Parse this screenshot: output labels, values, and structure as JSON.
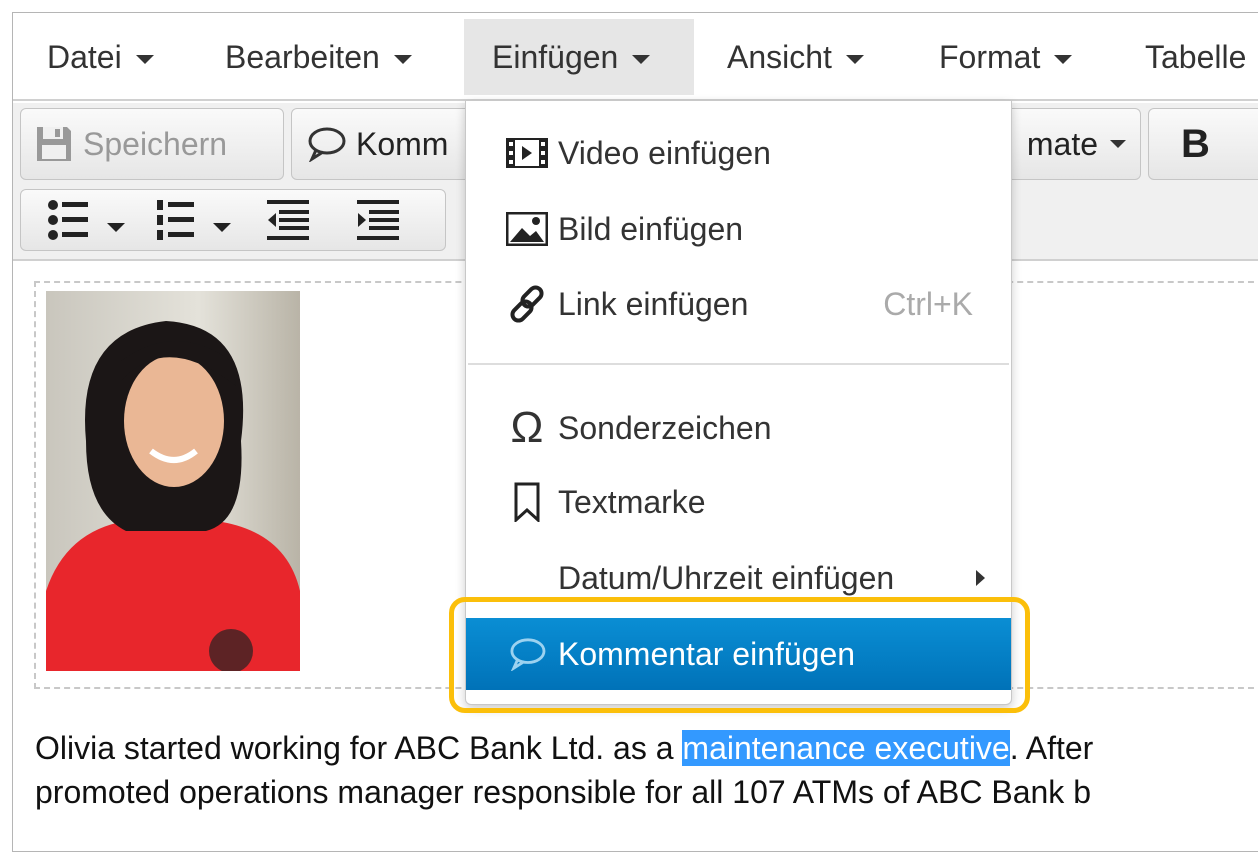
{
  "menubar": {
    "items": [
      {
        "label": "Datei"
      },
      {
        "label": "Bearbeiten"
      },
      {
        "label": "Einfügen",
        "active": true
      },
      {
        "label": "Ansicht"
      },
      {
        "label": "Format"
      },
      {
        "label": "Tabelle"
      }
    ]
  },
  "toolbar": {
    "save_label": "Speichern",
    "comment_label": "Komm",
    "formats_label": "mate",
    "bold_label": "B"
  },
  "dropdown": {
    "items": [
      {
        "label": "Video einfügen",
        "icon": "film-icon"
      },
      {
        "label": "Bild einfügen",
        "icon": "image-icon"
      },
      {
        "label": "Link einfügen",
        "icon": "link-icon",
        "shortcut": "Ctrl+K"
      },
      {
        "label": "Sonderzeichen",
        "icon": "omega-icon"
      },
      {
        "label": "Textmarke",
        "icon": "bookmark-icon"
      },
      {
        "label": "Datum/Uhrzeit einfügen",
        "submenu": true
      },
      {
        "label": "Kommentar einfügen",
        "icon": "comment-icon",
        "highlighted": true
      }
    ]
  },
  "content": {
    "line1_before": "Olivia started working for ABC Bank Ltd. as a ",
    "line1_selected": "maintenance executive",
    "line1_after": ". After",
    "line2": "promoted operations manager responsible for all 107 ATMs of ABC Bank b"
  },
  "colors": {
    "highlight": "#0a7fc6",
    "selection": "#3399ff",
    "annotation_ring": "#fbbf0a"
  }
}
